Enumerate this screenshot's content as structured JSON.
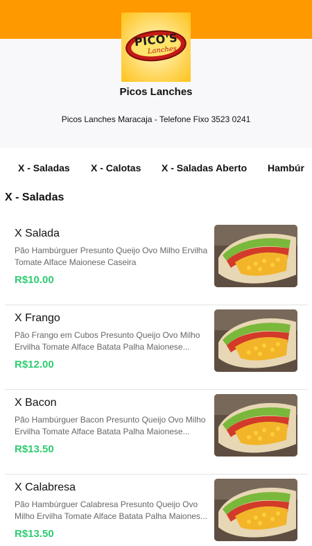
{
  "header": {
    "logo_text": "PICO'S",
    "logo_subtext": "Lanches",
    "store_name": "Picos Lanches",
    "store_info": "Picos Lanches Maracaja - Telefone Fixo 3523 0241",
    "colors": {
      "band": "#ff9900",
      "panel": "#f8f8fa"
    }
  },
  "tabs": [
    {
      "label": "X - Saladas"
    },
    {
      "label": "X - Calotas"
    },
    {
      "label": "X - Saladas Aberto"
    },
    {
      "label": "Hambúr"
    }
  ],
  "section": {
    "title": "X - Saladas"
  },
  "items": [
    {
      "name": "X Salada",
      "description": "Pão Hambúrguer Presunto Queijo Ovo Milho Ervilha Tomate Alface Maionese Caseira",
      "price": "R$10.00",
      "image": "burger-wrap-photo"
    },
    {
      "name": "X Frango",
      "description": "Pão Frango em Cubos Presunto Queijo Ovo Milho Ervilha Tomate Alface Batata Palha Maionese...",
      "price": "R$12.00",
      "image": "burger-wrap-photo"
    },
    {
      "name": "X Bacon",
      "description": "Pão Hambúrguer Bacon Presunto Queijo Ovo Milho Ervilha Tomate Alface Batata Palha Maionese...",
      "price": "R$13.50",
      "image": "burger-wrap-photo"
    },
    {
      "name": "X Calabresa",
      "description": "Pão Hambúrguer Calabresa Presunto Queijo Ovo Milho Ervilha Tomate Alface Batata Palha Maiones...",
      "price": "R$13.50",
      "image": "burger-wrap-photo"
    }
  ],
  "colors": {
    "price": "#2ecc71"
  }
}
